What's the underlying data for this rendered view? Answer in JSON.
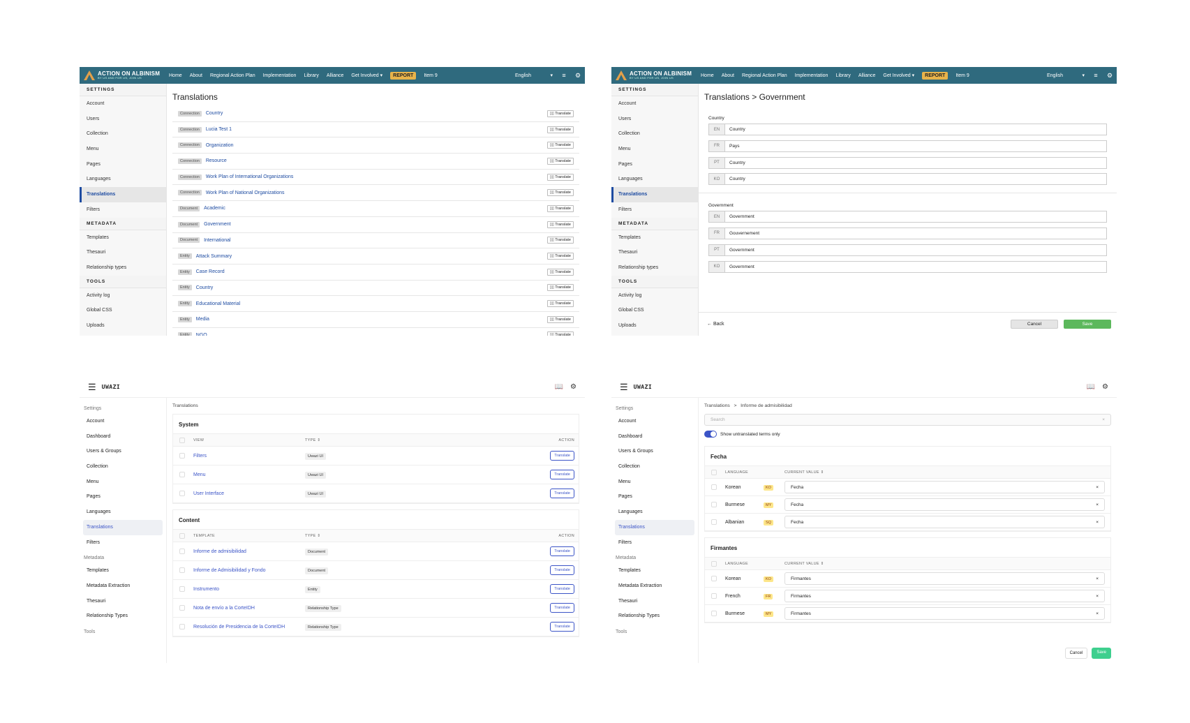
{
  "old_nav": {
    "logo_title": "ACTION ON ALBINISM",
    "logo_sub": "BY US AND FOR US, JOIN US",
    "items": [
      "Home",
      "About",
      "Regional Action Plan",
      "Implementation",
      "Library",
      "Alliance",
      "Get Involved ▾",
      "REPORT",
      "Item 9"
    ],
    "language": "English",
    "lang_caret": "▾",
    "menu_icon": "≡",
    "settings_icon": "⚙"
  },
  "old_sidebar": {
    "settings_header": "SETTINGS",
    "settings_items": [
      "Account",
      "Users",
      "Collection",
      "Menu",
      "Pages",
      "Languages",
      "Translations",
      "Filters"
    ],
    "metadata_header": "METADATA",
    "metadata_items": [
      "Templates",
      "Thesauri",
      "Relationship types"
    ],
    "tools_header": "TOOLS",
    "tools_items": [
      "Activity log",
      "Global CSS",
      "Uploads"
    ]
  },
  "panel1": {
    "title": "Translations",
    "translate_label": "▯▯ Translate",
    "rows": [
      {
        "tag": "Connection",
        "name": "Country"
      },
      {
        "tag": "Connection",
        "name": "Lucia Test 1"
      },
      {
        "tag": "Connection",
        "name": "Organization"
      },
      {
        "tag": "Connection",
        "name": "Resource"
      },
      {
        "tag": "Connection",
        "name": "Work Plan of International Organizations"
      },
      {
        "tag": "Connection",
        "name": "Work Plan of National Organizations"
      },
      {
        "tag": "Document",
        "name": "Academic"
      },
      {
        "tag": "Document",
        "name": "Government"
      },
      {
        "tag": "Document",
        "name": "International"
      },
      {
        "tag": "Entity",
        "name": "Attack Summary"
      },
      {
        "tag": "Entity",
        "name": "Case Record"
      },
      {
        "tag": "Entity",
        "name": "Country"
      },
      {
        "tag": "Entity",
        "name": "Educational Material"
      },
      {
        "tag": "Entity",
        "name": "Media"
      },
      {
        "tag": "Entity",
        "name": "NGO"
      }
    ]
  },
  "panel2": {
    "title": "Translations > Government",
    "groups": [
      {
        "label": "Country",
        "rows": [
          {
            "code": "EN",
            "value": "Country"
          },
          {
            "code": "FR",
            "value": "Pays"
          },
          {
            "code": "PT",
            "value": "Country"
          },
          {
            "code": "KO",
            "value": "Country"
          }
        ]
      },
      {
        "label": "Government",
        "rows": [
          {
            "code": "EN",
            "value": "Government"
          },
          {
            "code": "FR",
            "value": "Gouvernement"
          },
          {
            "code": "PT",
            "value": "Government"
          },
          {
            "code": "KO",
            "value": "Government"
          }
        ]
      }
    ],
    "back": "Back",
    "cancel": "Cancel",
    "save": "Save"
  },
  "new_top": {
    "brand": "UWAZI",
    "menu_icon": "☰",
    "book_icon": "📖",
    "gear_icon": "⚙"
  },
  "new_sidebar": {
    "settings_header": "Settings",
    "settings_items": [
      "Account",
      "Dashboard",
      "Users & Groups",
      "Collection",
      "Menu",
      "Pages",
      "Languages",
      "Translations",
      "Filters"
    ],
    "metadata_header": "Metadata",
    "metadata_items": [
      "Templates",
      "Metadata Extraction",
      "Thesauri",
      "Relationship Types"
    ],
    "tools_header": "Tools"
  },
  "panel3": {
    "breadcrumb": "Translations",
    "system_title": "System",
    "system_cols": [
      "VIEW",
      "TYPE ⇕",
      "ACTION"
    ],
    "system_rows": [
      {
        "name": "Filters",
        "type": "Uwazi UI"
      },
      {
        "name": "Menu",
        "type": "Uwazi UI"
      },
      {
        "name": "User Interface",
        "type": "Uwazi UI"
      }
    ],
    "content_title": "Content",
    "content_cols": [
      "TEMPLATE",
      "TYPE ⇕",
      "ACTION"
    ],
    "content_rows": [
      {
        "name": "Informe de admisibilidad",
        "type": "Document"
      },
      {
        "name": "Informe de Admisibilidad y Fondo",
        "type": "Document"
      },
      {
        "name": "Instrumento",
        "type": "Entity"
      },
      {
        "name": "Nota de envío a la CorteIDH",
        "type": "Relationship Type"
      },
      {
        "name": "Resolución de Presidencia de la CorteIDH",
        "type": "Relationship Type"
      }
    ],
    "translate_label": "Translate"
  },
  "panel4": {
    "breadcrumb_root": "Translations",
    "breadcrumb_sep": ">",
    "breadcrumb_leaf": "Informe de admisibilidad",
    "search_placeholder": "Search",
    "search_clear": "×",
    "toggle_label": "Show untranslated terms only",
    "cols": [
      "LANGUAGE",
      "CURRENT VALUE ⇕"
    ],
    "sections": [
      {
        "title": "Fecha",
        "rows": [
          {
            "lang": "Korean",
            "code": "KO",
            "value": "Fecha"
          },
          {
            "lang": "Burmese",
            "code": "MY",
            "value": "Fecha"
          },
          {
            "lang": "Albanian",
            "code": "SQ",
            "value": "Fecha"
          }
        ]
      },
      {
        "title": "Firmantes",
        "rows": [
          {
            "lang": "Korean",
            "code": "KO",
            "value": "Firmantes"
          },
          {
            "lang": "French",
            "code": "FR",
            "value": "Firmantes"
          },
          {
            "lang": "Burmese",
            "code": "MY",
            "value": "Firmantes"
          }
        ]
      }
    ],
    "clear": "×",
    "cancel": "Cancel",
    "save": "Save"
  }
}
